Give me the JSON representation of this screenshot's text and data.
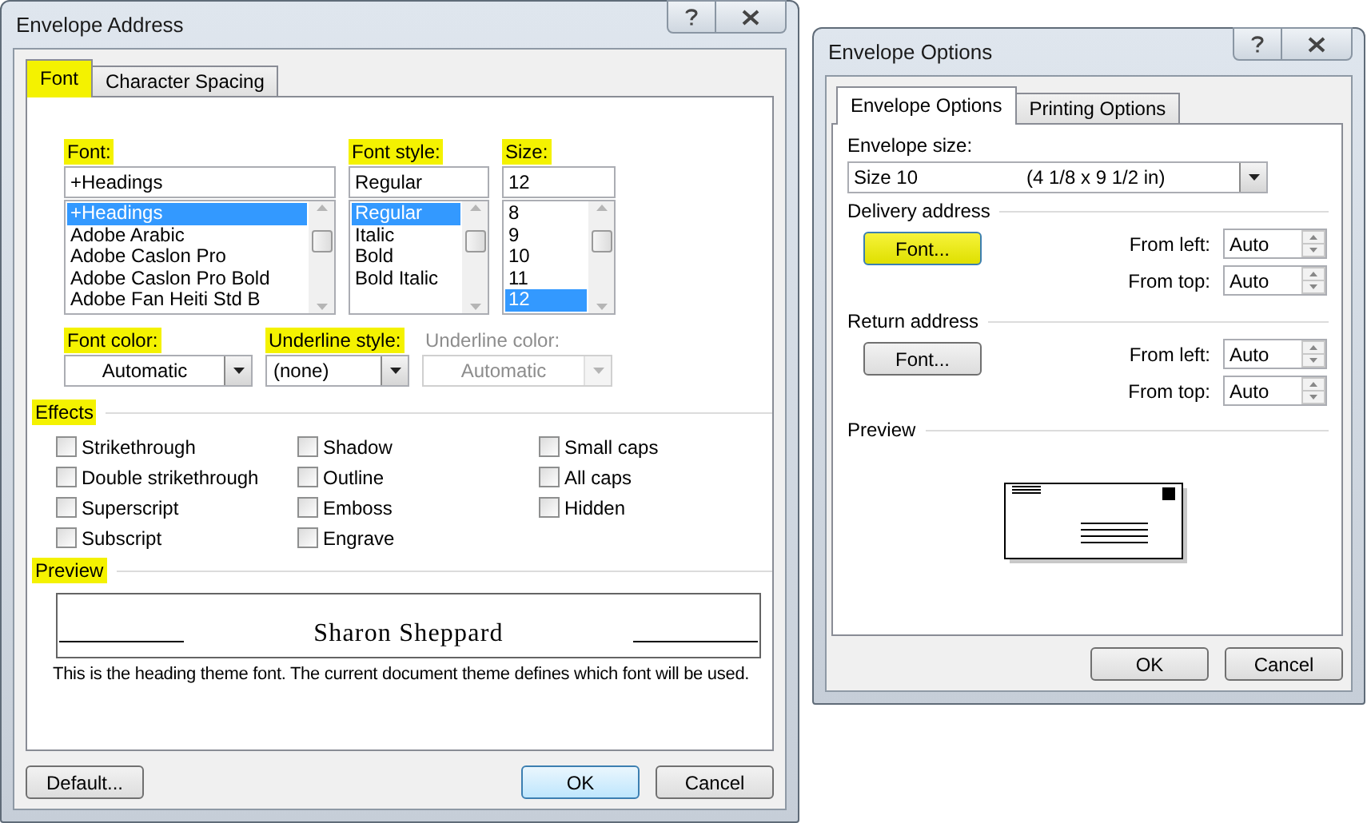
{
  "envelope_address": {
    "title": "Envelope Address",
    "tabs": [
      {
        "label": "Font",
        "selected": true,
        "highlighted": true
      },
      {
        "label": "Character Spacing",
        "selected": false,
        "highlighted": false
      }
    ],
    "font": {
      "label": "Font:",
      "highlighted": true,
      "value": "+Headings",
      "items": [
        {
          "text": "+Headings",
          "selected": true
        },
        {
          "text": "Adobe Arabic",
          "selected": false
        },
        {
          "text": "Adobe Caslon Pro",
          "selected": false
        },
        {
          "text": "Adobe Caslon Pro Bold",
          "selected": false
        },
        {
          "text": "Adobe Fan Heiti Std B",
          "selected": false
        }
      ]
    },
    "font_style": {
      "label": "Font style:",
      "highlighted": true,
      "value": "Regular",
      "items": [
        {
          "text": "Regular",
          "selected": true
        },
        {
          "text": "Italic",
          "selected": false
        },
        {
          "text": "Bold",
          "selected": false
        },
        {
          "text": "Bold Italic",
          "selected": false
        }
      ]
    },
    "size": {
      "label": "Size:",
      "highlighted": true,
      "value": "12",
      "items": [
        {
          "text": "8",
          "selected": false
        },
        {
          "text": "9",
          "selected": false
        },
        {
          "text": "10",
          "selected": false
        },
        {
          "text": "11",
          "selected": false
        },
        {
          "text": "12",
          "selected": true
        }
      ]
    },
    "dropdowns": [
      {
        "label": "Font color:",
        "highlighted": true,
        "value": "Automatic",
        "disabled": false
      },
      {
        "label": "Underline style:",
        "highlighted": true,
        "value": "(none)",
        "disabled": false
      },
      {
        "label": "Underline color:",
        "highlighted": false,
        "value": "Automatic",
        "disabled": true
      }
    ],
    "effects": {
      "heading": "Effects",
      "highlighted": true,
      "columns": [
        [
          {
            "label": "Strikethrough",
            "checked": false
          },
          {
            "label": "Double strikethrough",
            "checked": false
          },
          {
            "label": "Superscript",
            "checked": false
          },
          {
            "label": "Subscript",
            "checked": false
          }
        ],
        [
          {
            "label": "Shadow",
            "checked": false
          },
          {
            "label": "Outline",
            "checked": false
          },
          {
            "label": "Emboss",
            "checked": false
          },
          {
            "label": "Engrave",
            "checked": false
          }
        ],
        [
          {
            "label": "Small caps",
            "checked": false
          },
          {
            "label": "All caps",
            "checked": false
          },
          {
            "label": "Hidden",
            "checked": false
          }
        ]
      ]
    },
    "preview": {
      "heading": "Preview",
      "highlighted": true,
      "sample": "Sharon Sheppard",
      "description": "This is the heading theme font. The current document theme defines which font will be used."
    },
    "buttons": [
      {
        "label": "Default...",
        "default": false
      },
      {
        "label": "OK",
        "default": true
      },
      {
        "label": "Cancel",
        "default": false
      }
    ]
  },
  "envelope_options": {
    "title": "Envelope Options",
    "tabs": [
      {
        "label": "Envelope Options",
        "selected": true
      },
      {
        "label": "Printing Options",
        "selected": false
      }
    ],
    "envelope_size": {
      "label": "Envelope size:",
      "size": "Size 10",
      "dimensions": "(4 1/8 x 9 1/2 in)"
    },
    "addresses": [
      {
        "heading": "Delivery address",
        "font_button": {
          "label": "Font...",
          "highlighted": true
        },
        "from_left": {
          "label": "From left:",
          "value": "Auto"
        },
        "from_top": {
          "label": "From top:",
          "value": "Auto"
        }
      },
      {
        "heading": "Return address",
        "font_button": {
          "label": "Font...",
          "highlighted": false
        },
        "from_left": {
          "label": "From left:",
          "value": "Auto"
        },
        "from_top": {
          "label": "From top:",
          "value": "Auto"
        }
      }
    ],
    "preview": {
      "heading": "Preview"
    },
    "buttons": [
      {
        "label": "OK",
        "default": false
      },
      {
        "label": "Cancel",
        "default": false
      }
    ]
  }
}
